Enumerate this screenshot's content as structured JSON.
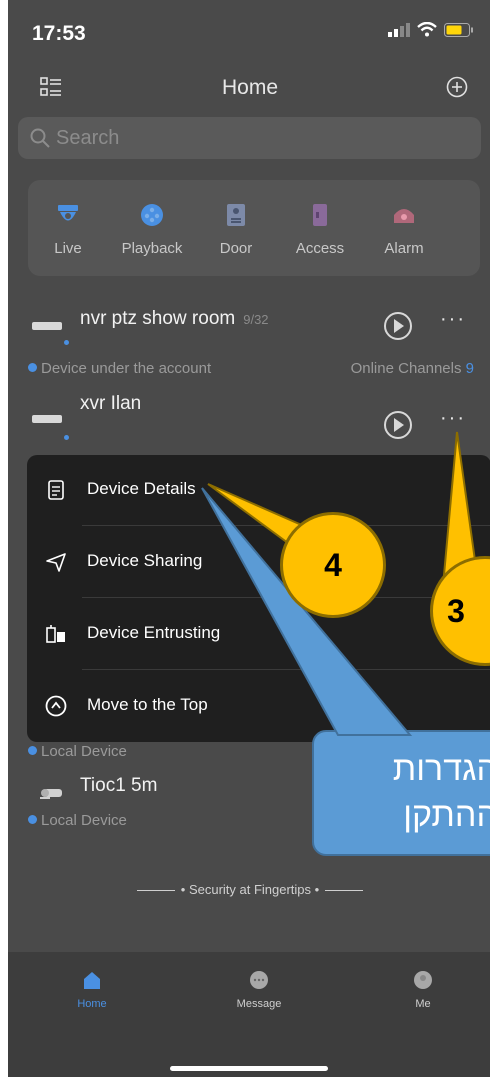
{
  "status": {
    "time": "17:53"
  },
  "header": {
    "title": "Home"
  },
  "search": {
    "placeholder": "Search"
  },
  "quick_actions": [
    {
      "label": "Live",
      "icon": "camera-dome-icon"
    },
    {
      "label": "Playback",
      "icon": "playback-reel-icon"
    },
    {
      "label": "Door",
      "icon": "door-phone-icon"
    },
    {
      "label": "Access",
      "icon": "access-card-icon"
    },
    {
      "label": "Alarm",
      "icon": "alarm-bell-icon"
    }
  ],
  "devices": [
    {
      "name": "nvr ptz show room",
      "count": "9/32"
    },
    {
      "name": "xvr Ilan"
    },
    {
      "name": "Tioc1 5m"
    }
  ],
  "groups": {
    "account_label": "Device under the account",
    "online_label": "Online Channels",
    "online_count": "9",
    "local_label": "Local Device"
  },
  "menu": {
    "items": [
      {
        "label": "Device Details",
        "icon": "document-icon"
      },
      {
        "label": "Device Sharing",
        "icon": "send-icon"
      },
      {
        "label": "Device Entrusting",
        "icon": "entrust-icon"
      },
      {
        "label": "Move to the Top",
        "icon": "move-top-icon"
      }
    ]
  },
  "tagline": "Security at Fingertips",
  "tabs": [
    {
      "label": "Home",
      "active": true
    },
    {
      "label": "Message",
      "active": false
    },
    {
      "label": "Me",
      "active": false
    }
  ],
  "annotations": {
    "step3": "3",
    "step4": "4",
    "callout_text": "הגדרות\nההתקן"
  },
  "colors": {
    "accent_blue": "#4a90e2",
    "callout_yellow": "#ffc000",
    "callout_blue": "#5b9bd5"
  }
}
